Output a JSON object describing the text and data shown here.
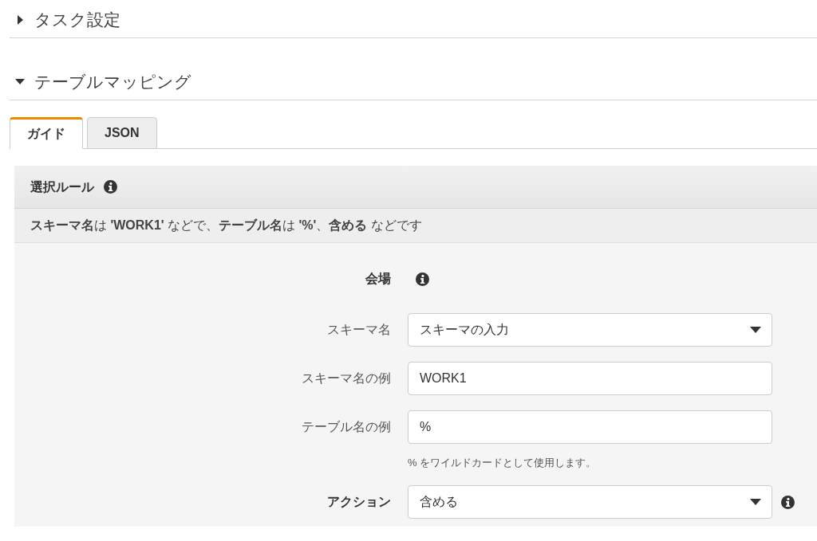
{
  "sections": [
    {
      "title": "タスク設定",
      "expanded": false
    },
    {
      "title": "テーブルマッピング",
      "expanded": true,
      "tabs": [
        {
          "label": "ガイド",
          "selected": true
        },
        {
          "label": "JSON",
          "selected": false
        }
      ],
      "rule_panel": {
        "title": "選択ルール",
        "info": true,
        "summary": "**スキーマ名**は **'WORK1'** などで、**テーブル名**は **'%'**、**含める** などです",
        "fields": [
          {
            "kind": "heading",
            "label": "会場",
            "label_bold": true,
            "info": true
          },
          {
            "kind": "select",
            "label": "スキーマ名",
            "label_bold": false,
            "value": "スキーマの入力",
            "info": false
          },
          {
            "kind": "input",
            "label": "スキーマ名の例",
            "label_bold": false,
            "value": "WORK1",
            "info": false
          },
          {
            "kind": "input",
            "label": "テーブル名の例",
            "label_bold": false,
            "value": "%",
            "hint": "% をワイルドカードとして使用します。",
            "info": false
          },
          {
            "kind": "select",
            "label": "アクション",
            "label_bold": true,
            "value": "含める",
            "info": true
          }
        ]
      }
    }
  ]
}
